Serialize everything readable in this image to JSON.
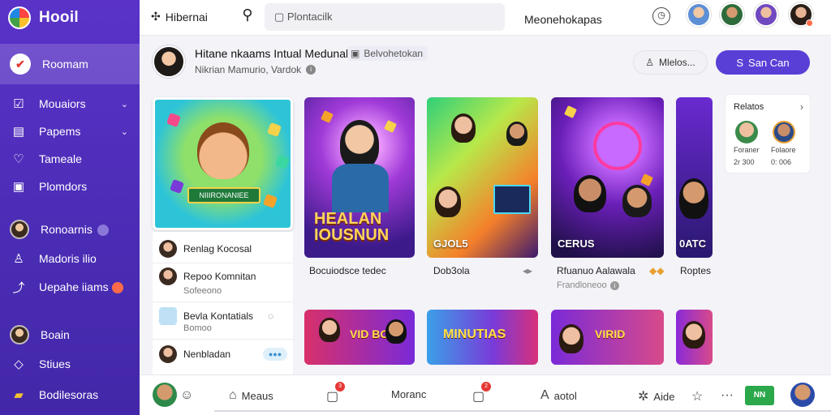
{
  "brand": {
    "name": "Hooil"
  },
  "sidebar": {
    "items": [
      {
        "label": "Roomam",
        "icon": "app-logo-icon",
        "active": true
      },
      {
        "label": "Mouaiors",
        "icon": "check-square-icon",
        "chevron": true
      },
      {
        "label": "Papems",
        "icon": "document-icon",
        "chevron": true
      },
      {
        "label": "Tameale",
        "icon": "heart-icon"
      },
      {
        "label": "Plomdors",
        "icon": "square-icon"
      },
      {
        "label": "Ronoarnis",
        "icon": "avatar",
        "badge": true
      },
      {
        "label": "Madoris ilio",
        "icon": "people-icon"
      },
      {
        "label": "Uepahe iiams",
        "icon": "chart-icon",
        "badge_red": true
      },
      {
        "label": "Boain",
        "icon": "avatar"
      },
      {
        "label": "Stiues",
        "icon": "tag-icon"
      },
      {
        "label": "Bodilesoras",
        "icon": "bag-icon"
      }
    ]
  },
  "topbar": {
    "title": "Hibernai",
    "search_placeholder": "Plontacilk",
    "center_label": "Meonehokapas"
  },
  "header": {
    "name": "Hitane nkaams Intual Medunal",
    "chip": "Belvohetokan",
    "subtitle": "Nikrian Mamurio, Vardok",
    "ghost_button": "Mlelos...",
    "primary_button": "San Can"
  },
  "promo": {
    "banner": "NIIIRONANIEE"
  },
  "list": [
    {
      "title": "Renlag Kocosal",
      "sub": ""
    },
    {
      "title": "Repoo Komnitan",
      "sub": "Sofeeono"
    },
    {
      "title": "Bevla Kontatials",
      "sub": "Bomoo"
    },
    {
      "title": "Nenbladan",
      "sub": ""
    }
  ],
  "videos": [
    {
      "overlay_big": "HEALAN IOUSNUN",
      "caption": "Bocuiodsce tedec",
      "sub": ""
    },
    {
      "overlay_label": "GJOL5",
      "caption": "Dob3ola",
      "sub": ""
    },
    {
      "overlay_label": "CERUS",
      "caption": "Rfuanuo Aalawala",
      "sub": "Frandloneoo"
    },
    {
      "overlay_label": "0ATC",
      "caption": "Roptes",
      "sub": ""
    }
  ],
  "small_videos": [
    {
      "title": "VID BONG"
    },
    {
      "title": "MINUTIAS"
    },
    {
      "title": "VIRID"
    },
    {
      "title": ""
    }
  ],
  "related": {
    "title": "Relatos",
    "people": [
      {
        "name": "Foraner",
        "num": "2r 300"
      },
      {
        "name": "Folaore",
        "num": "0: 006"
      }
    ]
  },
  "bottombar": {
    "items": [
      {
        "label": "Meaus",
        "icon": "home-icon"
      },
      {
        "label": "Moranc",
        "icon": "bell-icon",
        "notif": "3"
      },
      {
        "label": "aotol",
        "icon": "letter-a-icon",
        "notif": "2"
      },
      {
        "label": "Aide",
        "icon": "gear-icon"
      }
    ],
    "green_badge": "NN"
  },
  "colors": {
    "sidebar": "#5a32c8",
    "primary": "#5a3fd6",
    "accent_red": "#ff6b4a"
  }
}
